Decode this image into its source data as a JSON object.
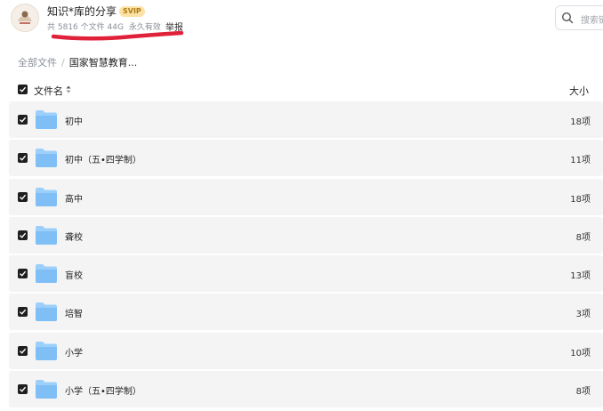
{
  "header": {
    "title": "知识*库的分享",
    "vip": "SVIP",
    "file_info": "共 5816 个文件 44G",
    "validity": "永久有效",
    "report": "举报",
    "search_placeholder": "搜索链"
  },
  "breadcrumb": {
    "root": "全部文件",
    "separator": "/",
    "current": "国家智慧教育..."
  },
  "list_header": {
    "name": "文件名",
    "size": "大小"
  },
  "folders": [
    {
      "name": "初中",
      "count": "18项"
    },
    {
      "name": "初中（五•四学制）",
      "count": "11项"
    },
    {
      "name": "高中",
      "count": "18项"
    },
    {
      "name": "聋校",
      "count": "8项"
    },
    {
      "name": "盲校",
      "count": "13项"
    },
    {
      "name": "培智",
      "count": "3项"
    },
    {
      "name": "小学",
      "count": "10项"
    },
    {
      "name": "小学（五•四学制）",
      "count": "8项"
    }
  ],
  "colors": {
    "folder": "#7fbff6",
    "checkbox": "#1f1f1f",
    "row_bg": "#f4f4f5",
    "annotation_red": "#e0213a"
  },
  "icons": {
    "search": "search-icon",
    "folder": "folder-icon",
    "checkbox": "checkbox-icon",
    "sort": "sort-icon"
  }
}
